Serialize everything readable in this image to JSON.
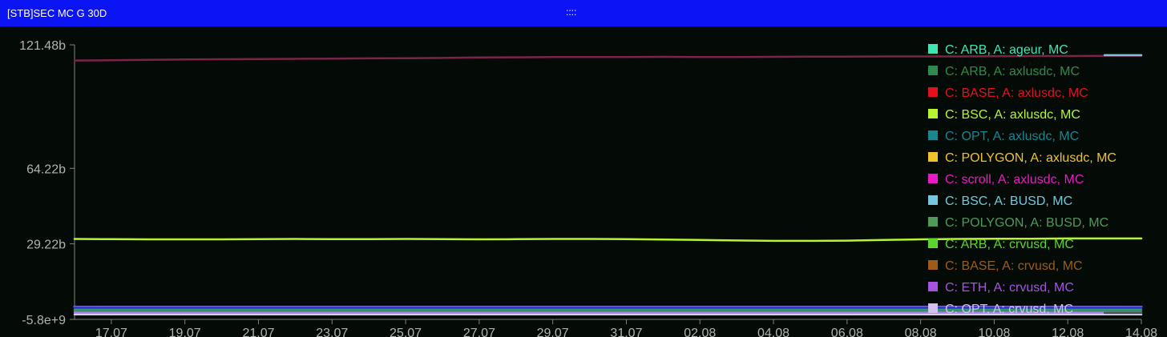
{
  "window": {
    "title": "[STB]SEC MC G 30D",
    "drag_handle": "::::"
  },
  "colors": {
    "title_bar": "#0b14f5",
    "background": "#040b07",
    "axis": "#7d8580",
    "tick_text": "#aeb3b0"
  },
  "chart_data": {
    "type": "line",
    "title": "",
    "xlabel": "",
    "ylabel": "",
    "grid": false,
    "legend_placement": "top-right",
    "x": [
      "16.07",
      "17.07",
      "18.07",
      "19.07",
      "20.07",
      "21.07",
      "22.07",
      "23.07",
      "24.07",
      "25.07",
      "26.07",
      "27.07",
      "28.07",
      "29.07",
      "30.07",
      "31.07",
      "01.08",
      "02.08",
      "03.08",
      "04.08",
      "05.08",
      "06.08",
      "07.08",
      "08.08",
      "09.08",
      "10.08",
      "11.08",
      "12.08",
      "13.08",
      "14.08"
    ],
    "x_tick_labels": [
      "17.07",
      "19.07",
      "21.07",
      "23.07",
      "25.07",
      "27.07",
      "29.07",
      "31.07",
      "02.08",
      "04.08",
      "06.08",
      "08.08",
      "10.08",
      "12.08",
      "14.08"
    ],
    "y_tick_labels": [
      "121.48b",
      "64.22b",
      "29.22b",
      "-5.8e+9"
    ],
    "y_tick_values": [
      121.48,
      64.22,
      29.22,
      -5.8
    ],
    "y_unit": "billions",
    "ylim": [
      -5.8,
      121.48
    ],
    "series": [
      {
        "name": "C: ARB, A: ageur, MC",
        "color": "#3ee6b6",
        "values": [
          0,
          0,
          0,
          0,
          0,
          0,
          0,
          0,
          0,
          0,
          0,
          0,
          0,
          0,
          0,
          0,
          0,
          0,
          0,
          0,
          0,
          0,
          0,
          0,
          0,
          0,
          0,
          0,
          0,
          0
        ]
      },
      {
        "name": "C: ARB, A: axlusdc, MC",
        "color": "#2f8a4b",
        "values": [
          0,
          0,
          0,
          0,
          0,
          0,
          0,
          0,
          0,
          0,
          0,
          0,
          0,
          0,
          0,
          0,
          0,
          0,
          0,
          0,
          0,
          0,
          0,
          0,
          0,
          0,
          0,
          0,
          0,
          0
        ]
      },
      {
        "name": "C: BASE, A: axlusdc, MC",
        "color": "#e2121a",
        "values": [
          0,
          0,
          0,
          0,
          0,
          0,
          0,
          0,
          0,
          0,
          0,
          0,
          0,
          0,
          0,
          0,
          0,
          0,
          0,
          0,
          0,
          0,
          0,
          0,
          0,
          0,
          0,
          0,
          0,
          0
        ]
      },
      {
        "name": "C: BSC, A: axlusdc, MC",
        "color": "#b8f531",
        "values": [
          31.5,
          31.4,
          31.3,
          31.3,
          31.3,
          31.4,
          31.5,
          31.4,
          31.4,
          31.5,
          31.4,
          31.3,
          31.4,
          31.5,
          31.5,
          31.4,
          31.2,
          31.0,
          30.8,
          30.6,
          30.6,
          30.7,
          31.0,
          31.3,
          31.5,
          31.6,
          31.6,
          31.7,
          31.7,
          31.7
        ]
      },
      {
        "name": "C: OPT, A: axlusdc, MC",
        "color": "#17868f",
        "values": [
          0,
          0,
          0,
          0,
          0,
          0,
          0,
          0,
          0,
          0,
          0,
          0,
          0,
          0,
          0,
          0,
          0,
          0,
          0,
          0,
          0,
          0,
          0,
          0,
          0,
          0,
          0,
          0,
          0,
          0
        ]
      },
      {
        "name": "C: POLYGON, A: axlusdc, MC",
        "color": "#f0c22c",
        "values": [
          0,
          0,
          0,
          0,
          0,
          0,
          0,
          0,
          0,
          0,
          0,
          0,
          0,
          0,
          0,
          0,
          0,
          0,
          0,
          0,
          0,
          0,
          0,
          0,
          0,
          0,
          0,
          0,
          0,
          0
        ]
      },
      {
        "name": "C: scroll, A: axlusdc, MC",
        "color": "#e91bc5",
        "values": [
          0,
          0,
          0,
          0,
          0,
          0,
          0,
          0,
          0,
          0,
          0,
          0,
          0,
          0,
          0,
          0,
          0,
          0,
          0,
          0,
          0,
          0,
          0,
          0,
          0,
          0,
          0,
          0,
          0,
          0
        ]
      },
      {
        "name": "C: BSC, A: BUSD, MC",
        "color": "#75c7dd",
        "values": [
          0,
          0,
          0,
          0,
          0,
          0,
          0,
          0,
          0,
          0,
          0,
          0,
          0,
          0,
          0,
          0,
          0,
          0,
          0,
          0,
          0,
          0,
          0,
          0,
          0,
          0,
          0,
          0,
          0,
          0
        ]
      },
      {
        "name": "C: POLYGON, A: BUSD, MC",
        "color": "#4f9a59",
        "values": [
          0,
          0,
          0,
          0,
          0,
          0,
          0,
          0,
          0,
          0,
          0,
          0,
          0,
          0,
          0,
          0,
          0,
          0,
          0,
          0,
          0,
          0,
          0,
          0,
          0,
          0,
          0,
          0,
          0,
          0
        ]
      },
      {
        "name": "C: ARB, A: crvusd, MC",
        "color": "#5ad62c",
        "values": [
          0,
          0,
          0,
          0,
          0,
          0,
          0,
          0,
          0,
          0,
          0,
          0,
          0,
          0,
          0,
          0,
          0,
          0,
          0,
          0,
          0,
          0,
          0,
          0,
          0,
          0,
          0,
          0,
          0,
          0
        ]
      },
      {
        "name": "C: BASE, A: crvusd, MC",
        "color": "#9d5c15",
        "values": [
          0,
          0,
          0,
          0,
          0,
          0,
          0,
          0,
          0,
          0,
          0,
          0,
          0,
          0,
          0,
          0,
          0,
          0,
          0,
          0,
          0,
          0,
          0,
          0,
          0,
          0,
          0,
          0,
          0,
          0
        ]
      },
      {
        "name": "C: ETH, A: crvusd, MC",
        "color": "#a653e0",
        "values": [
          0,
          0,
          0,
          0,
          0,
          0,
          0,
          0,
          0,
          0,
          0,
          0,
          0,
          0,
          0,
          0,
          0,
          0,
          0,
          0,
          0,
          0,
          0,
          0,
          0,
          0,
          0,
          0,
          0,
          0
        ]
      },
      {
        "name": "C: OPT, A: crvusd, MC",
        "color": "#d2c1ee",
        "values": [
          0,
          0,
          0,
          0,
          0,
          0,
          0,
          0,
          0,
          0,
          0,
          0,
          0,
          0,
          0,
          0,
          0,
          0,
          0,
          0,
          0,
          0,
          0,
          0,
          0,
          0,
          0,
          0,
          0,
          0
        ]
      },
      {
        "name": "",
        "color": "#7a2547",
        "values": [
          114.2,
          114.3,
          114.5,
          114.7,
          114.8,
          114.9,
          115.0,
          115.1,
          115.2,
          115.3,
          115.4,
          115.6,
          115.7,
          115.8,
          115.8,
          115.8,
          115.9,
          115.8,
          115.8,
          115.9,
          116.0,
          116.0,
          116.1,
          116.1,
          116.1,
          116.2,
          116.3,
          116.3,
          116.4,
          116.4
        ]
      },
      {
        "name": "",
        "color": "#1c23d9",
        "values": [
          -0.2,
          -0.2,
          -0.2,
          -0.2,
          -0.2,
          -0.2,
          -0.2,
          -0.2,
          -0.2,
          -0.2,
          -0.2,
          -0.2,
          -0.2,
          -0.2,
          -0.2,
          -0.2,
          -0.2,
          -0.2,
          -0.2,
          -0.2,
          -0.2,
          -0.2,
          -0.2,
          -0.2,
          -0.2,
          -0.2,
          -0.2,
          -0.2,
          -0.2,
          -0.2
        ]
      },
      {
        "name": "",
        "color": "#3b3fe0",
        "values": [
          -0.6,
          -0.6,
          -0.6,
          -0.6,
          -0.6,
          -0.6,
          -0.6,
          -0.6,
          -0.6,
          -0.6,
          -0.6,
          -0.6,
          -0.6,
          -0.6,
          -0.6,
          -0.6,
          -0.6,
          -0.6,
          -0.6,
          -0.6,
          -0.6,
          -0.6,
          -0.6,
          -0.6,
          -0.6,
          -0.6,
          -0.6,
          -0.6,
          -0.6,
          -0.6
        ]
      },
      {
        "name": "",
        "color": "#2ea86b",
        "values": [
          -1.5,
          -1.5,
          -1.5,
          -1.5,
          -1.5,
          -1.5,
          -1.5,
          -1.5,
          -1.5,
          -1.5,
          -1.5,
          -1.5,
          -1.5,
          -1.5,
          -1.5,
          -1.5,
          -1.5,
          -1.5,
          -1.5,
          -1.5,
          -1.5,
          -1.5,
          -1.5,
          -1.5,
          -1.5,
          -1.5,
          -1.5,
          -1.5,
          -1.5,
          -1.5
        ]
      },
      {
        "name": "",
        "color": "#a67be8",
        "values": [
          -2.5,
          -2.5,
          -2.5,
          -2.5,
          -2.5,
          -2.5,
          -2.5,
          -2.5,
          -2.5,
          -2.5,
          -2.5,
          -2.5,
          -2.5,
          -2.5,
          -2.5,
          -2.5,
          -2.5,
          -2.5,
          -2.5,
          -2.5,
          -2.5,
          -2.5,
          -2.5,
          -2.5,
          -2.5,
          -2.5,
          -2.5,
          -2.5,
          -2.5,
          -2.5
        ]
      },
      {
        "name": "",
        "color": "#d8cdf2",
        "values": [
          -3.5,
          -3.5,
          -3.5,
          -3.5,
          -3.5,
          -3.5,
          -3.5,
          -3.5,
          -3.5,
          -3.5,
          -3.5,
          -3.5,
          -3.5,
          -3.5,
          -3.5,
          -3.5,
          -3.5,
          -3.5,
          -3.5,
          -3.5,
          -3.5,
          -3.5,
          -3.5,
          -3.5,
          -3.5,
          -3.5,
          -3.5,
          -3.5,
          -3.5,
          -3.5
        ]
      },
      {
        "name": "",
        "color": "#75c7dd",
        "values": [
          null,
          null,
          null,
          null,
          null,
          null,
          null,
          null,
          null,
          null,
          null,
          null,
          null,
          null,
          null,
          null,
          null,
          null,
          null,
          null,
          null,
          null,
          null,
          null,
          null,
          null,
          null,
          null,
          116.7,
          116.7
        ]
      },
      {
        "name": "",
        "color": "#4e4e52",
        "values": [
          null,
          null,
          null,
          null,
          null,
          null,
          null,
          null,
          null,
          null,
          null,
          null,
          null,
          null,
          null,
          null,
          null,
          null,
          null,
          null,
          null,
          null,
          null,
          null,
          null,
          null,
          null,
          null,
          -2.8,
          -2.8
        ]
      }
    ]
  }
}
